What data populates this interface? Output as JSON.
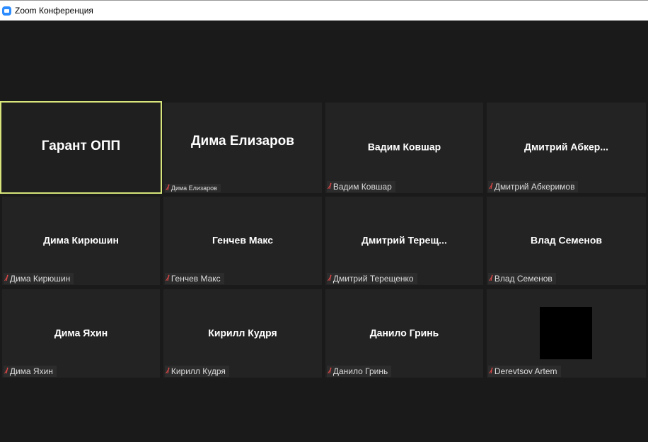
{
  "window": {
    "title": "Zoom Конференция"
  },
  "participants": [
    {
      "display": "Гарант ОПП",
      "label": ""
    },
    {
      "display": "Дима Елизаров",
      "label": "Дима Елизаров"
    },
    {
      "display": "Вадим Ковшар",
      "label": "Вадим Ковшар"
    },
    {
      "display": "Дмитрий  Абкер...",
      "label": "Дмитрий Абкеримов"
    },
    {
      "display": "Дима Кирюшин",
      "label": "Дима Кирюшин"
    },
    {
      "display": "Генчев Макс",
      "label": "Генчев Макс"
    },
    {
      "display": "Дмитрий  Терещ...",
      "label": "Дмитрий Терещенко"
    },
    {
      "display": "Влад Семенов",
      "label": "Влад Семенов"
    },
    {
      "display": "Дима Яхин",
      "label": "Дима Яхин"
    },
    {
      "display": "Кирилл Кудря",
      "label": "Кирилл Кудря"
    },
    {
      "display": "Данило Гринь",
      "label": "Данило Гринь"
    },
    {
      "display": "",
      "label": "Derevtsov Artem"
    }
  ],
  "colors": {
    "active_speaker": "#d7e57a",
    "muted": "#e04848"
  }
}
